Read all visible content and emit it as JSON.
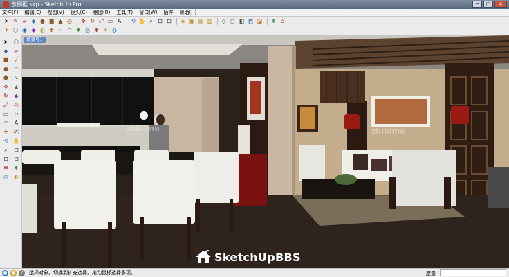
{
  "window": {
    "title": "示例框.skp - SketchUp Pro",
    "buttons": {
      "minimize": "─",
      "maximize": "□",
      "close": "✕"
    }
  },
  "menu": [
    "文件(F)",
    "编辑(E)",
    "视图(V)",
    "镜头(C)",
    "绘图(R)",
    "工具(T)",
    "窗口(W)",
    "插件",
    "帮助(H)"
  ],
  "scene": {
    "tab_label": "场景号1",
    "watermark_1": "zhibime",
    "watermark_2": "zhibime"
  },
  "brand": {
    "text": "SketchUpBBS"
  },
  "status": {
    "message": "选择对象。切换到扩充选择。拖动鼠标选择多项。",
    "measure_label": "度量",
    "measure_value": ""
  },
  "colors": {
    "title_bar": "#5a6b80",
    "scene_tab": "#5d86c4",
    "floor": "#2f241d"
  }
}
